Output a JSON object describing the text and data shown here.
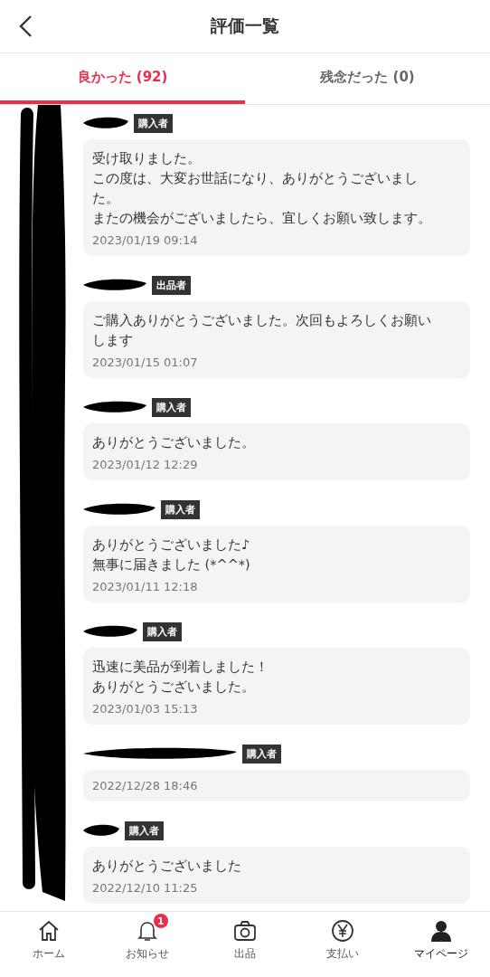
{
  "header": {
    "title": "評価一覧"
  },
  "tabs": [
    {
      "label": "良かった (92)",
      "selected": true
    },
    {
      "label": "残念だった (0)",
      "selected": false
    }
  ],
  "reviews": [
    {
      "role": "購入者",
      "comment": [
        "受け取りました。",
        "この度は、大変お世話になり、ありがとうございました。",
        "またの機会がございましたら、宜しくお願い致します。"
      ],
      "date": "2023/01/19 09:14"
    },
    {
      "role": "出品者",
      "comment": [
        "ご購入ありがとうございました。次回もよろしくお願いします"
      ],
      "date": "2023/01/15 01:07"
    },
    {
      "role": "購入者",
      "comment": [
        "ありがとうございました。"
      ],
      "date": "2023/01/12 12:29"
    },
    {
      "role": "購入者",
      "comment": [
        "ありがとうございました♪",
        "無事に届きました (*^^*)"
      ],
      "date": "2023/01/11 12:18"
    },
    {
      "role": "購入者",
      "comment": [
        "迅速に美品が到着しました！",
        "ありがとうございました。"
      ],
      "date": "2023/01/03 15:13"
    },
    {
      "role": "購入者",
      "date": "2022/12/28 18:46"
    },
    {
      "role": "購入者",
      "comment": [
        "ありがとうございました"
      ],
      "date": "2022/12/10 11:25"
    }
  ],
  "nav": [
    {
      "kind": "home",
      "label": "ホーム",
      "selected": false
    },
    {
      "kind": "bell",
      "label": "お知らせ",
      "badge": "1",
      "selected": false
    },
    {
      "kind": "camera",
      "label": "出品",
      "selected": false
    },
    {
      "kind": "yen",
      "label": "支払い",
      "selected": false
    },
    {
      "kind": "person",
      "label": "マイページ",
      "selected": true
    }
  ]
}
